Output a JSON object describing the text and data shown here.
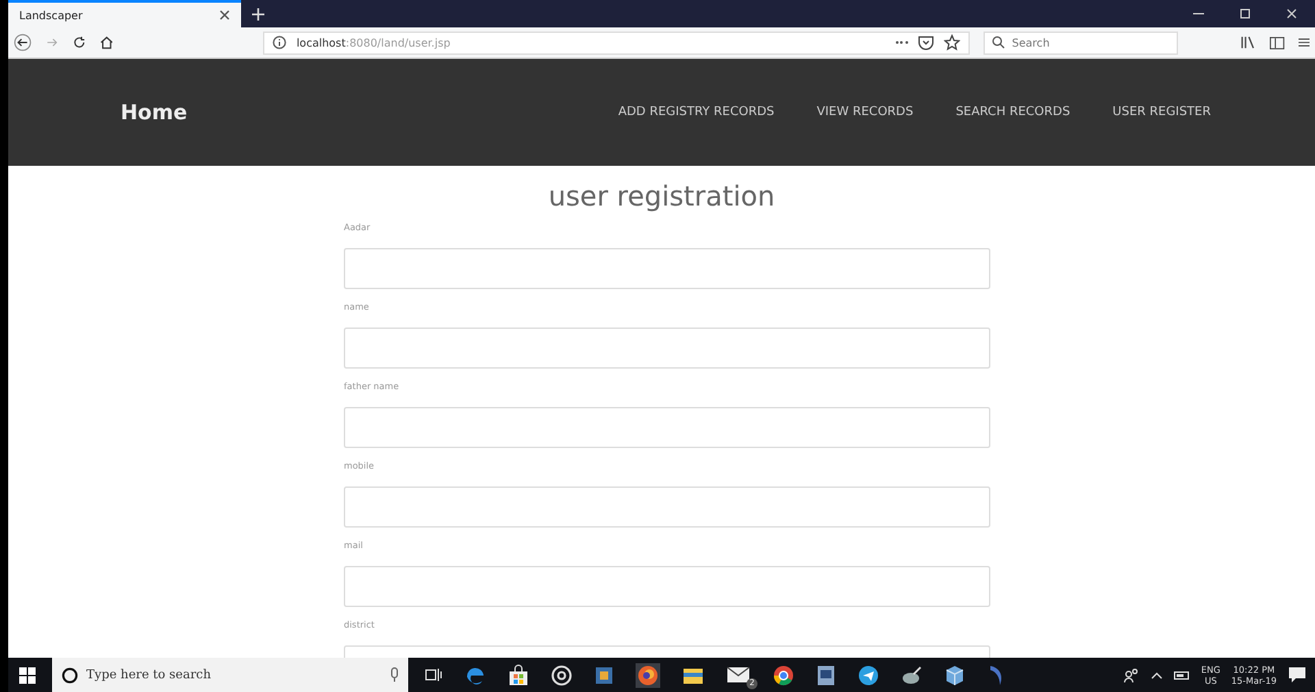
{
  "browser": {
    "tab_title": "Landscaper",
    "url_host": "localhost",
    "url_rest": ":8080/land/user.jsp",
    "search_placeholder": "Search"
  },
  "navbar": {
    "brand": "Home",
    "links": [
      "ADD REGISTRY RECORDS",
      "VIEW RECORDS",
      "SEARCH RECORDS",
      "USER REGISTER"
    ]
  },
  "form": {
    "title": "user registration",
    "fields": [
      {
        "label": "Aadar"
      },
      {
        "label": "name"
      },
      {
        "label": "father name"
      },
      {
        "label": "mobile"
      },
      {
        "label": "mail"
      },
      {
        "label": "district"
      }
    ]
  },
  "taskbar": {
    "search_placeholder": "Type here to search",
    "mail_badge": "2",
    "language": "ENG",
    "region": "US",
    "time": "10:22 PM",
    "date": "15-Mar-19"
  }
}
